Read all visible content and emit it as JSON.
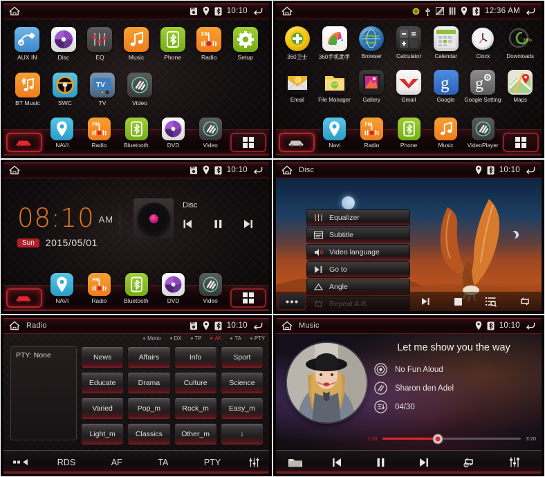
{
  "panels": {
    "home_apps": {
      "statusbar": {
        "time": "10:10",
        "icons": [
          "sd-card-icon",
          "location-icon",
          "bluetooth-icon"
        ],
        "back": "back-icon",
        "home": "home-icon"
      },
      "row1": [
        {
          "label": "AUX IN",
          "icon": "aux-plug-icon"
        },
        {
          "label": "Disc",
          "icon": "disc-icon"
        },
        {
          "label": "EQ",
          "icon": "equalizer-icon"
        },
        {
          "label": "Music",
          "icon": "music-note-icon"
        },
        {
          "label": "Phone",
          "icon": "bluetooth-phone-icon"
        },
        {
          "label": "Radio",
          "icon": "fm-radio-icon"
        },
        {
          "label": "Setup",
          "icon": "gear-icon"
        }
      ],
      "row2": [
        {
          "label": "BT Music",
          "icon": "bluetooth-music-icon"
        },
        {
          "label": "SWC",
          "icon": "steering-wheel-icon"
        },
        {
          "label": "TV",
          "icon": "tv-icon"
        },
        {
          "label": "Video",
          "icon": "video-icon"
        }
      ],
      "dock": [
        {
          "label": "NAVI",
          "icon": "map-pin-icon"
        },
        {
          "label": "Radio",
          "icon": "fm-radio-icon"
        },
        {
          "label": "Bluetooth",
          "icon": "bluetooth-icon"
        },
        {
          "label": "DVD",
          "icon": "disc-icon"
        },
        {
          "label": "Video",
          "icon": "video-icon"
        }
      ],
      "car_button": "car-icon",
      "apps_button": "app-drawer-icon"
    },
    "android_apps": {
      "statusbar": {
        "time": "12:36 AM",
        "icons": [
          "sync-icon",
          "usb-icon",
          "screenshot-icon",
          "sim-icon",
          "location-icon",
          "bluetooth-icon"
        ],
        "back": "back-icon",
        "home": "home-icon"
      },
      "row1": [
        {
          "label": "360卫士",
          "icon": "360-guard-icon"
        },
        {
          "label": "360手机助手",
          "icon": "360-assistant-icon"
        },
        {
          "label": "Browser",
          "icon": "globe-icon"
        },
        {
          "label": "Calculator",
          "icon": "calculator-icon"
        },
        {
          "label": "Calendar",
          "icon": "calendar-icon"
        },
        {
          "label": "Clock",
          "icon": "clock-icon"
        },
        {
          "label": "Downloads",
          "icon": "download-icon",
          "badge": "36%"
        }
      ],
      "row2": [
        {
          "label": "Email",
          "icon": "email-icon"
        },
        {
          "label": "File Manager",
          "icon": "folder-icon"
        },
        {
          "label": "Gallery",
          "icon": "gallery-icon"
        },
        {
          "label": "Gmail",
          "icon": "gmail-icon"
        },
        {
          "label": "Google",
          "icon": "google-g-icon"
        },
        {
          "label": "Google Settings",
          "icon": "google-settings-icon"
        },
        {
          "label": "Maps",
          "icon": "maps-icon"
        }
      ],
      "dock": [
        {
          "label": "Navi",
          "icon": "map-pin-icon"
        },
        {
          "label": "Radio",
          "icon": "fm-radio-icon"
        },
        {
          "label": "Phone",
          "icon": "bluetooth-phone-icon"
        },
        {
          "label": "Music",
          "icon": "music-note-icon"
        },
        {
          "label": "VideoPlayer",
          "icon": "video-icon"
        }
      ],
      "car_button": "car-icon",
      "apps_button": "app-drawer-icon"
    },
    "home_clock": {
      "statusbar": {
        "time": "10:10",
        "icons": [
          "sd-card-icon",
          "location-icon",
          "bluetooth-icon"
        ],
        "back": "back-icon",
        "home": "home-icon"
      },
      "clock": {
        "time": "08:10",
        "ampm": "AM",
        "weekday": "Sun",
        "date": "2015/05/01"
      },
      "now_playing": {
        "source": "Disc",
        "art": "vinyl-record",
        "prev": "previous-track-icon",
        "pause": "pause-icon",
        "next": "next-track-icon"
      },
      "dock": [
        {
          "label": "NAVI",
          "icon": "map-pin-icon"
        },
        {
          "label": "Radio",
          "icon": "fm-radio-icon"
        },
        {
          "label": "Bluetooth",
          "icon": "bluetooth-icon"
        },
        {
          "label": "DVD",
          "icon": "disc-icon"
        },
        {
          "label": "Video",
          "icon": "video-icon"
        }
      ],
      "car_button": "car-icon",
      "apps_button": "app-drawer-icon"
    },
    "disc": {
      "statusbar": {
        "title": "Disc",
        "time": "10:10",
        "icons": [
          "location-icon",
          "bluetooth-icon"
        ],
        "back": "back-icon",
        "home": "home-icon"
      },
      "menu": [
        {
          "label": "Equalizer",
          "icon": "equalizer-icon"
        },
        {
          "label": "Subtitle",
          "icon": "subtitle-icon"
        },
        {
          "label": "Video language",
          "icon": "audio-language-icon"
        },
        {
          "label": "Go to",
          "icon": "goto-icon"
        },
        {
          "label": "Angle",
          "icon": "angle-icon"
        },
        {
          "label": "Repeat A-B",
          "icon": "repeat-ab-icon"
        }
      ],
      "toolbar": {
        "more": "more-options-icon",
        "buttons": [
          "next-track-icon",
          "stop-icon",
          "playlist-search-icon",
          "repeat-icon"
        ]
      }
    },
    "radio": {
      "statusbar": {
        "title": "Radio",
        "time": "10:10",
        "icons": [
          "sd-card-icon",
          "location-icon",
          "bluetooth-icon"
        ],
        "back": "back-icon",
        "home": "home-icon"
      },
      "indicators": [
        {
          "label": "Mono",
          "active": false
        },
        {
          "label": "DX",
          "active": false
        },
        {
          "label": "TP",
          "active": false
        },
        {
          "label": "AF",
          "active": true
        },
        {
          "label": "TA",
          "active": false
        },
        {
          "label": "PTY",
          "active": false
        }
      ],
      "pty_display": "PTY:  None",
      "pty_buttons": [
        "News",
        "Affairs",
        "Info",
        "Sport",
        "Educate",
        "Drama",
        "Culture",
        "Science",
        "Varied",
        "Pop_m",
        "Rock_m",
        "Easy_m",
        "Light_m",
        "Classics",
        "Other_m",
        "↓"
      ],
      "bottom": {
        "left_icon": "back-list-icon",
        "tabs": [
          "RDS",
          "AF",
          "TA",
          "PTY"
        ],
        "right_icon": "equalizer-icon"
      }
    },
    "music": {
      "statusbar": {
        "title": "Music",
        "time": "10:10",
        "icons": [
          "location-icon",
          "bluetooth-icon"
        ],
        "back": "back-icon",
        "home": "home-icon"
      },
      "song": {
        "title": "Let me show you the way",
        "album": "No Fun Aloud",
        "artist": "Sharon den Adel",
        "track": "04/30",
        "album_icon": "disc-icon",
        "artist_icon": "artist-icon",
        "track_icon": "track-list-icon"
      },
      "progress": {
        "current": "1:20",
        "total": "3:20",
        "percent": 40
      },
      "bottom": {
        "folder_icon": "folder-icon",
        "buttons": [
          "previous-track-icon",
          "pause-icon",
          "next-track-icon",
          "repeat-one-icon",
          "equalizer-icon"
        ]
      }
    }
  },
  "colors": {
    "accent_red": "#b3202a",
    "orange": "#ee7b1e",
    "active_red": "#e4262e",
    "progress_red": "#e12630"
  }
}
